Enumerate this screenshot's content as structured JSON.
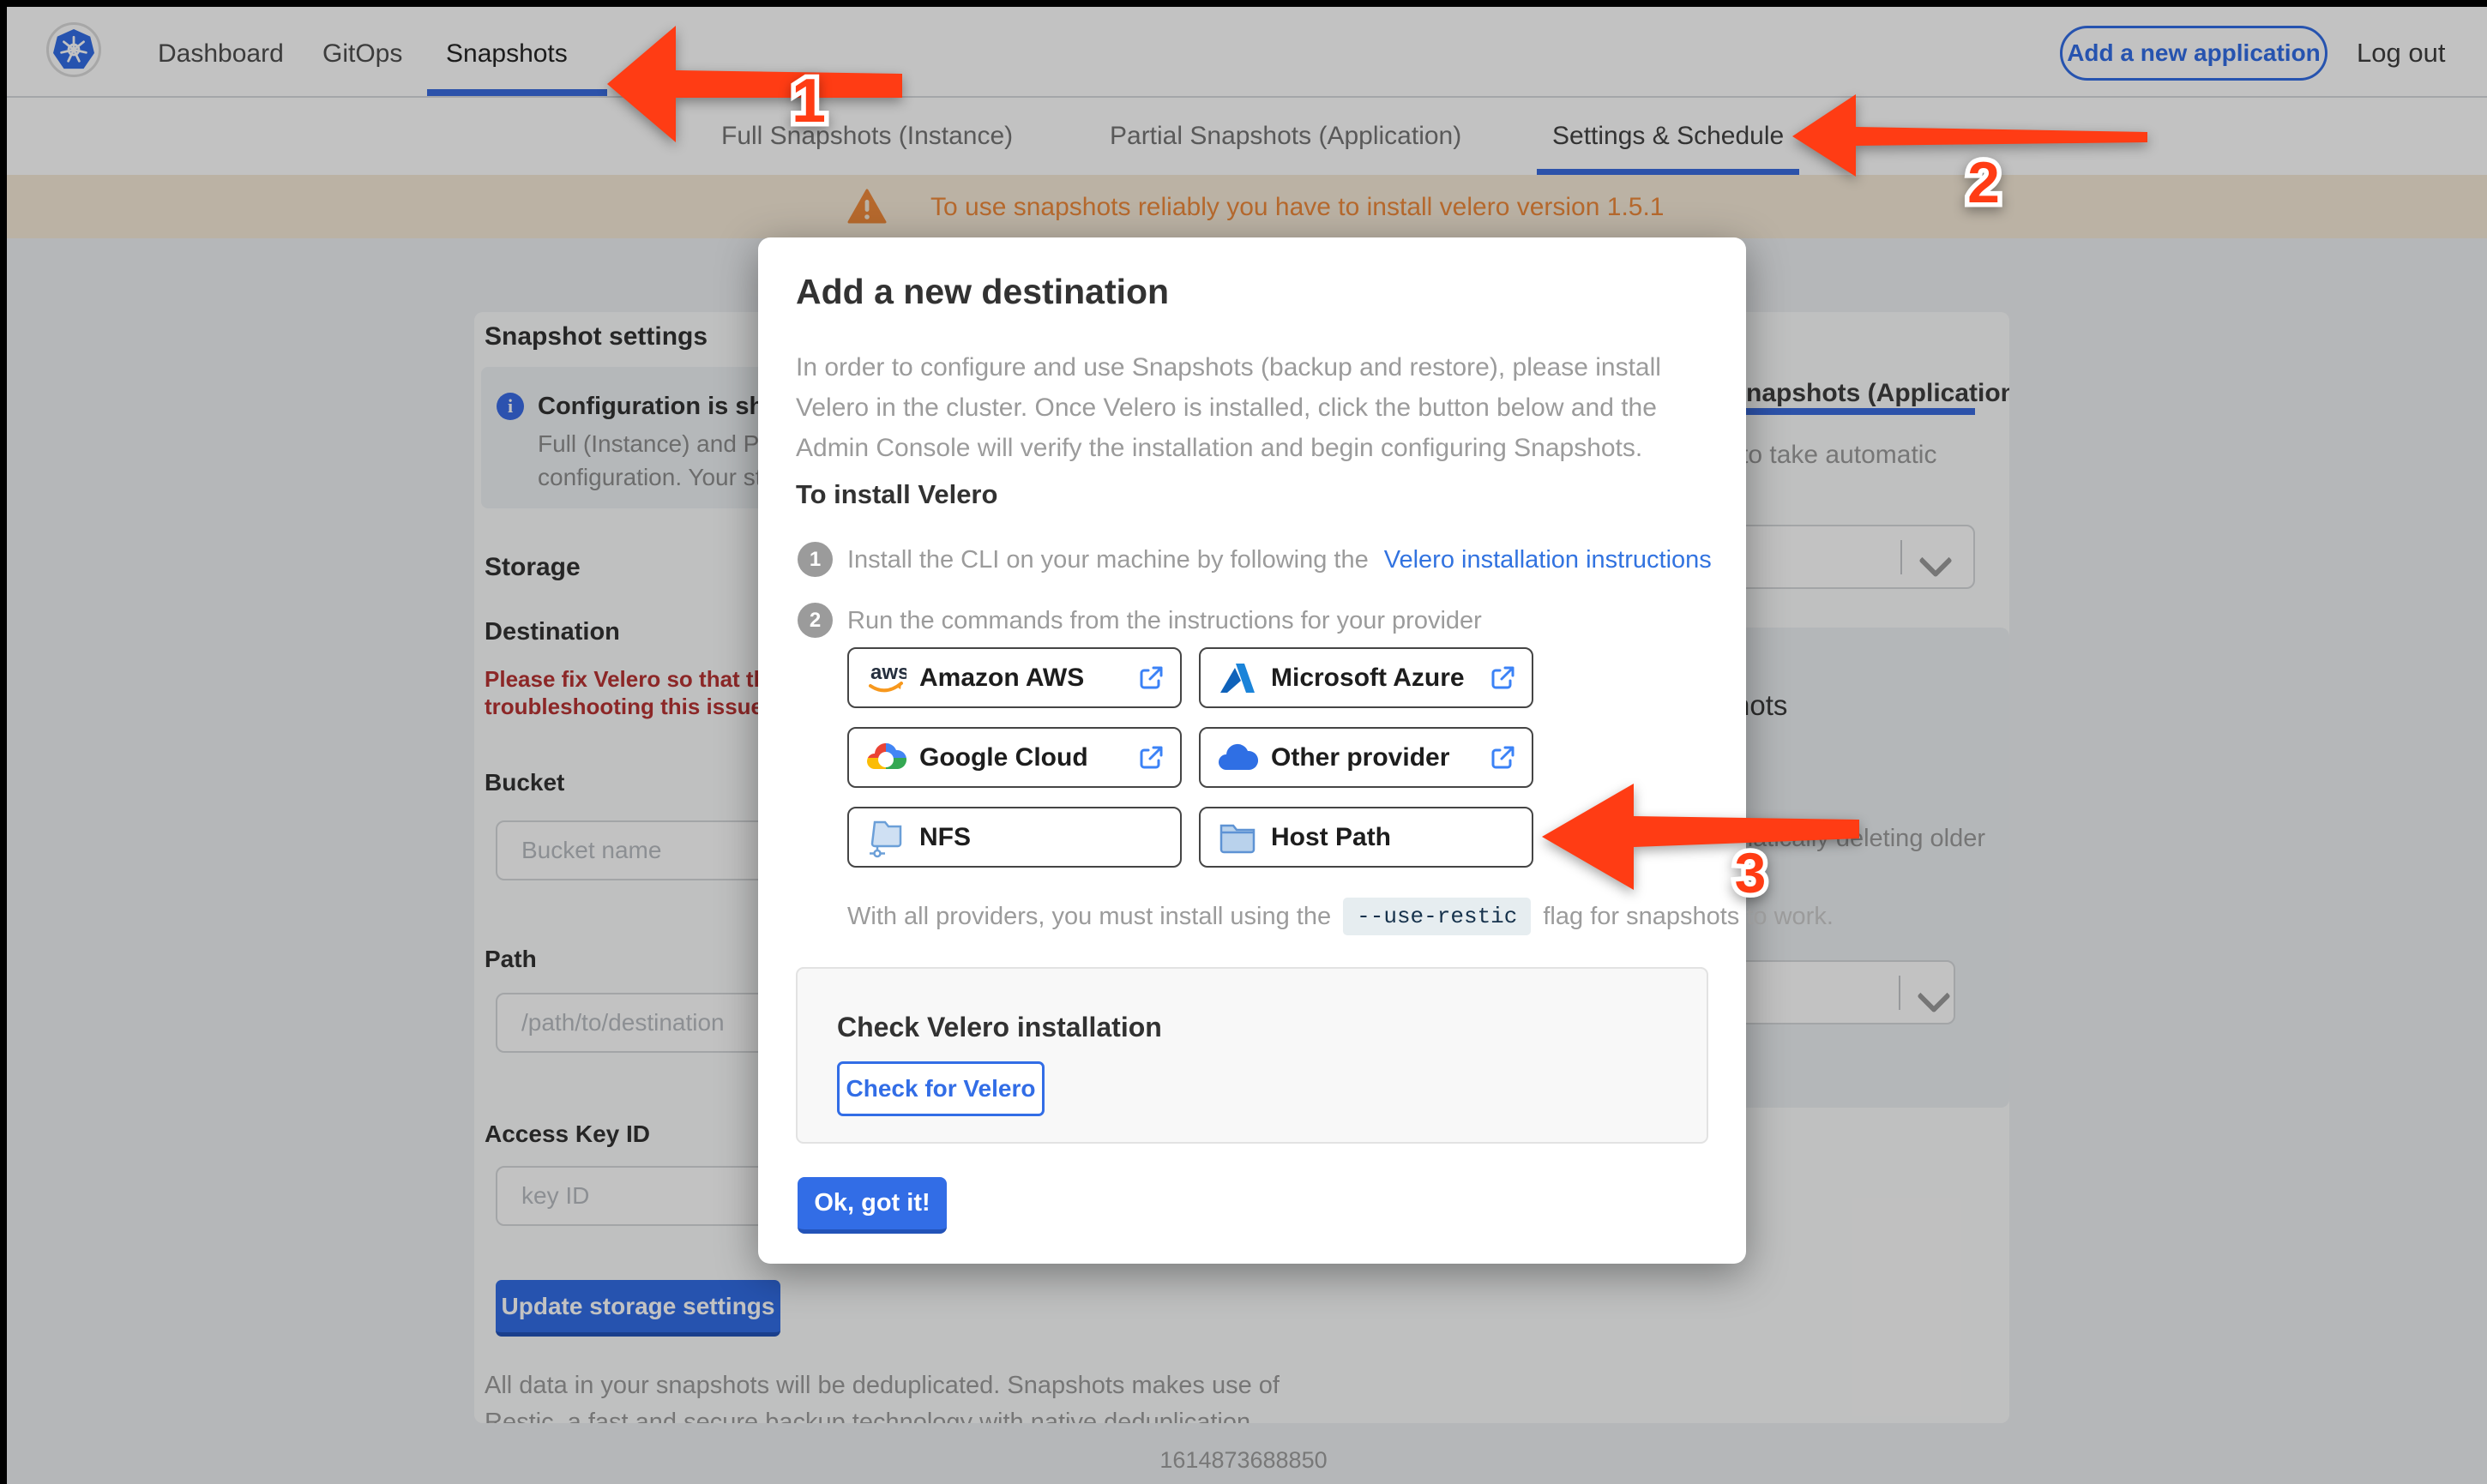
{
  "nav": {
    "logo": "kubernetes-logo",
    "items": [
      {
        "label": "Dashboard"
      },
      {
        "label": "GitOps"
      },
      {
        "label": "Snapshots",
        "active": true
      }
    ],
    "add_app_label": "Add a new application",
    "logout_label": "Log out"
  },
  "tabs": {
    "items": [
      {
        "label": "Full Snapshots (Instance)"
      },
      {
        "label": "Partial Snapshots (Application)"
      },
      {
        "label": "Settings & Schedule",
        "active": true
      }
    ]
  },
  "banner": {
    "text": "To use snapshots reliably you have to install velero version 1.5.1"
  },
  "settings": {
    "title": "Snapshot settings",
    "info": {
      "title_fragment": "Configuration is sh",
      "line1_fragment": "Full (Instance) and Parti",
      "line2_fragment": "configuration. Your stor"
    },
    "storage_heading": "Storage",
    "destination_heading": "Destination",
    "error_line1": "Please fix Velero so that th",
    "error_line2": "troubleshooting this issue",
    "fields": [
      {
        "label": "Bucket",
        "placeholder": "Bucket name",
        "value": ""
      },
      {
        "label": "Path",
        "placeholder": "/path/to/destination",
        "value": ""
      },
      {
        "label": "Access Key ID",
        "placeholder": "key ID",
        "value": ""
      }
    ],
    "update_button": "Update storage settings",
    "footnote_line1": "All data in your snapshots will be deduplicated. Snapshots makes use of",
    "footnote_line2": "Restic, a fast and secure backup technology with native deduplication."
  },
  "right_panel": {
    "tab_fragment": "napshots (Application)",
    "desc_fragment": "to take automatic",
    "heading_fragment": "hots",
    "retention_fragment": "matically deleting older"
  },
  "footer": {
    "timestamp": "1614873688850"
  },
  "modal": {
    "title": "Add a new destination",
    "intro_line1": "In order to configure and use Snapshots (backup and restore), please install",
    "intro_line2": "Velero in the cluster. Once Velero is installed, click the button below and the",
    "intro_line3": "Admin Console will verify the installation and begin configuring Snapshots.",
    "install_heading": "To install Velero",
    "step1_num": "1",
    "step1_text": "Install the CLI on your machine by following the",
    "step1_link": "Velero installation instructions",
    "step2_num": "2",
    "step2_text": "Run the commands from the instructions for your provider",
    "providers": [
      {
        "label": "Amazon AWS",
        "icon": "aws-logo",
        "external": true
      },
      {
        "label": "Microsoft Azure",
        "icon": "azure-logo",
        "external": true
      },
      {
        "label": "Google Cloud",
        "icon": "google-cloud-logo",
        "external": true
      },
      {
        "label": "Other provider",
        "icon": "cloud-icon",
        "external": true
      },
      {
        "label": "NFS",
        "icon": "nfs-network-folder-icon",
        "external": false
      },
      {
        "label": "Host Path",
        "icon": "folder-icon",
        "external": false
      }
    ],
    "restic_before": "With all providers, you must install using the",
    "restic_flag": "--use-restic",
    "restic_after": "flag for snapshots to work.",
    "check_heading": "Check Velero installation",
    "check_button": "Check for Velero",
    "ok_button": "Ok, got it!"
  },
  "annotations": {
    "step1": "1",
    "step2": "2",
    "step3": "3"
  },
  "colors": {
    "accent_blue": "#326de6",
    "arrow_red": "#ff3c14",
    "warning_orange": "#ef8a3c",
    "error_red": "#b93434"
  }
}
